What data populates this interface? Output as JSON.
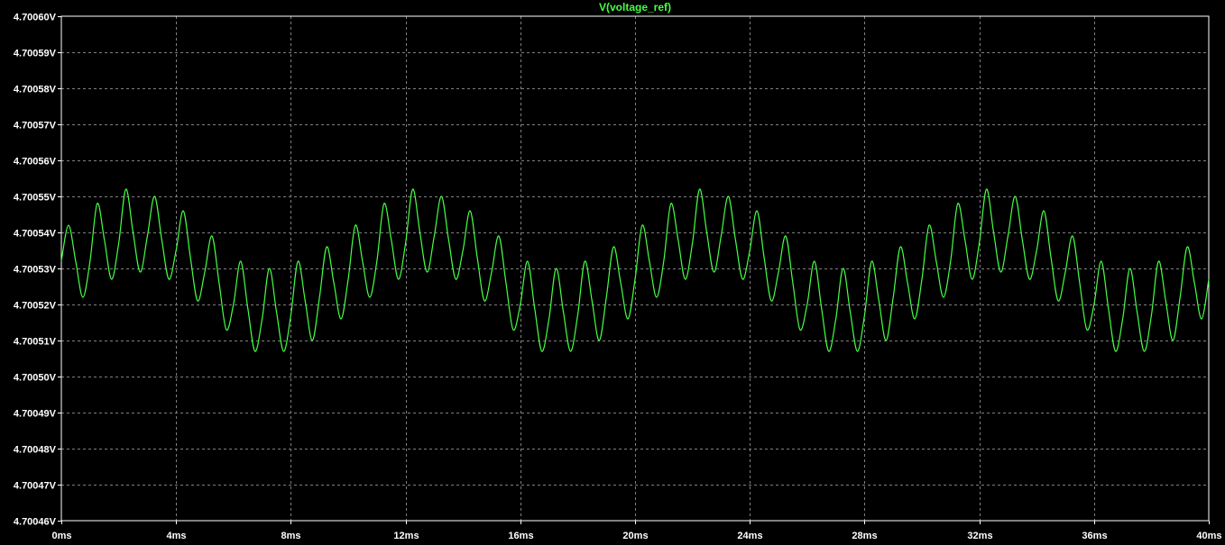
{
  "window": {
    "background": "#000000",
    "foreground": "#ffffff",
    "trace_color": "#44ff44"
  },
  "chart_data": {
    "type": "line",
    "title": "V(voltage_ref)",
    "xlabel": "",
    "ylabel": "",
    "x_unit": "ms",
    "y_unit": "V",
    "xlim": [
      0,
      40
    ],
    "ylim": [
      4.70046,
      4.7006
    ],
    "grid": true,
    "x_ticks": [
      "0ms",
      "4ms",
      "8ms",
      "12ms",
      "16ms",
      "20ms",
      "24ms",
      "28ms",
      "32ms",
      "36ms",
      "40ms"
    ],
    "x_tick_values": [
      0,
      4,
      8,
      12,
      16,
      20,
      24,
      28,
      32,
      36,
      40
    ],
    "y_ticks": [
      "4.70060V",
      "4.70059V",
      "4.70058V",
      "4.70057V",
      "4.70056V",
      "4.70055V",
      "4.70054V",
      "4.70053V",
      "4.70052V",
      "4.70051V",
      "4.70050V",
      "4.70049V",
      "4.70048V",
      "4.70047V",
      "4.70046V"
    ],
    "y_tick_values": [
      4.7006,
      4.70059,
      4.70058,
      4.70057,
      4.70056,
      4.70055,
      4.70054,
      4.70053,
      4.70052,
      4.70051,
      4.7005,
      4.70049,
      4.70048,
      4.70047,
      4.70046
    ],
    "series": [
      {
        "name": "V(voltage_ref)",
        "color": "#44ff44",
        "x": [
          0,
          0.25,
          0.5,
          0.75,
          1,
          1.25,
          1.5,
          1.75,
          2,
          2.25,
          2.5,
          2.75,
          3,
          3.25,
          3.5,
          3.75,
          4,
          4.25,
          4.5,
          4.75,
          5,
          5.25,
          5.5,
          5.75,
          6,
          6.25,
          6.5,
          6.75,
          7,
          7.25,
          7.5,
          7.75,
          8,
          8.25,
          8.5,
          8.75,
          9,
          9.25,
          9.5,
          9.75,
          10,
          10.25,
          10.5,
          10.75,
          11,
          11.25,
          11.5,
          11.75,
          12,
          12.25,
          12.5,
          12.75,
          13,
          13.25,
          13.5,
          13.75,
          14,
          14.25,
          14.5,
          14.75,
          15,
          15.25,
          15.5,
          15.75,
          16,
          16.25,
          16.5,
          16.75,
          17,
          17.25,
          17.5,
          17.75,
          18,
          18.25,
          18.5,
          18.75,
          19,
          19.25,
          19.5,
          19.75,
          20,
          20.25,
          20.5,
          20.75,
          21,
          21.25,
          21.5,
          21.75,
          22,
          22.25,
          22.5,
          22.75,
          23,
          23.25,
          23.5,
          23.75,
          24,
          24.25,
          24.5,
          24.75,
          25,
          25.25,
          25.5,
          25.75,
          26,
          26.25,
          26.5,
          26.75,
          27,
          27.25,
          27.5,
          27.75,
          28,
          28.25,
          28.5,
          28.75,
          29,
          29.25,
          29.5,
          29.75,
          30,
          30.25,
          30.5,
          30.75,
          31,
          31.25,
          31.5,
          31.75,
          32,
          32.25,
          32.5,
          32.75,
          33,
          33.25,
          33.5,
          33.75,
          34,
          34.25,
          34.5,
          34.75,
          35,
          35.25,
          35.5,
          35.75,
          36,
          36.25,
          36.5,
          36.75,
          37,
          37.25,
          37.5,
          37.75,
          38,
          38.25,
          38.5,
          38.75,
          39,
          39.25,
          39.5,
          39.75,
          40
        ],
        "y": [
          4.700532,
          4.700542,
          4.700532,
          4.700522,
          4.700532,
          4.700548,
          4.700538,
          4.700527,
          4.700537,
          4.700552,
          4.70054,
          4.700529,
          4.700539,
          4.70055,
          4.700538,
          4.700527,
          4.700535,
          4.700546,
          4.700533,
          4.700521,
          4.700529,
          4.700539,
          4.700526,
          4.700513,
          4.70052,
          4.700532,
          4.700519,
          4.700507,
          4.700516,
          4.70053,
          4.700518,
          4.700507,
          4.700517,
          4.700532,
          4.700521,
          4.70051,
          4.700522,
          4.700536,
          4.700526,
          4.700516,
          4.700527,
          4.700542,
          4.700532,
          4.700522,
          4.700532,
          4.700548,
          4.700538,
          4.700527,
          4.700537,
          4.700552,
          4.70054,
          4.700529,
          4.700539,
          4.70055,
          4.700538,
          4.700527,
          4.700535,
          4.700546,
          4.700533,
          4.700521,
          4.700529,
          4.700539,
          4.700526,
          4.700513,
          4.70052,
          4.700532,
          4.700519,
          4.700507,
          4.700516,
          4.70053,
          4.700518,
          4.700507,
          4.700517,
          4.700532,
          4.700521,
          4.70051,
          4.700522,
          4.700536,
          4.700526,
          4.700516,
          4.700527,
          4.700542,
          4.700532,
          4.700522,
          4.700532,
          4.700548,
          4.700538,
          4.700527,
          4.700537,
          4.700552,
          4.70054,
          4.700529,
          4.700539,
          4.70055,
          4.700538,
          4.700527,
          4.700535,
          4.700546,
          4.700533,
          4.700521,
          4.700529,
          4.700539,
          4.700526,
          4.700513,
          4.70052,
          4.700532,
          4.700519,
          4.700507,
          4.700516,
          4.70053,
          4.700518,
          4.700507,
          4.700517,
          4.700532,
          4.700521,
          4.70051,
          4.700522,
          4.700536,
          4.700526,
          4.700516,
          4.700527,
          4.700542,
          4.700532,
          4.700522,
          4.700532,
          4.700548,
          4.700538,
          4.700527,
          4.700537,
          4.700552,
          4.70054,
          4.700529,
          4.700539,
          4.70055,
          4.700538,
          4.700527,
          4.700535,
          4.700546,
          4.700533,
          4.700521,
          4.700529,
          4.700539,
          4.700526,
          4.700513,
          4.70052,
          4.700532,
          4.700519,
          4.700507,
          4.700516,
          4.70053,
          4.700518,
          4.700507,
          4.700517,
          4.700532,
          4.700521,
          4.70051,
          4.700522,
          4.700536,
          4.700526,
          4.700516,
          4.700527
        ]
      }
    ]
  }
}
